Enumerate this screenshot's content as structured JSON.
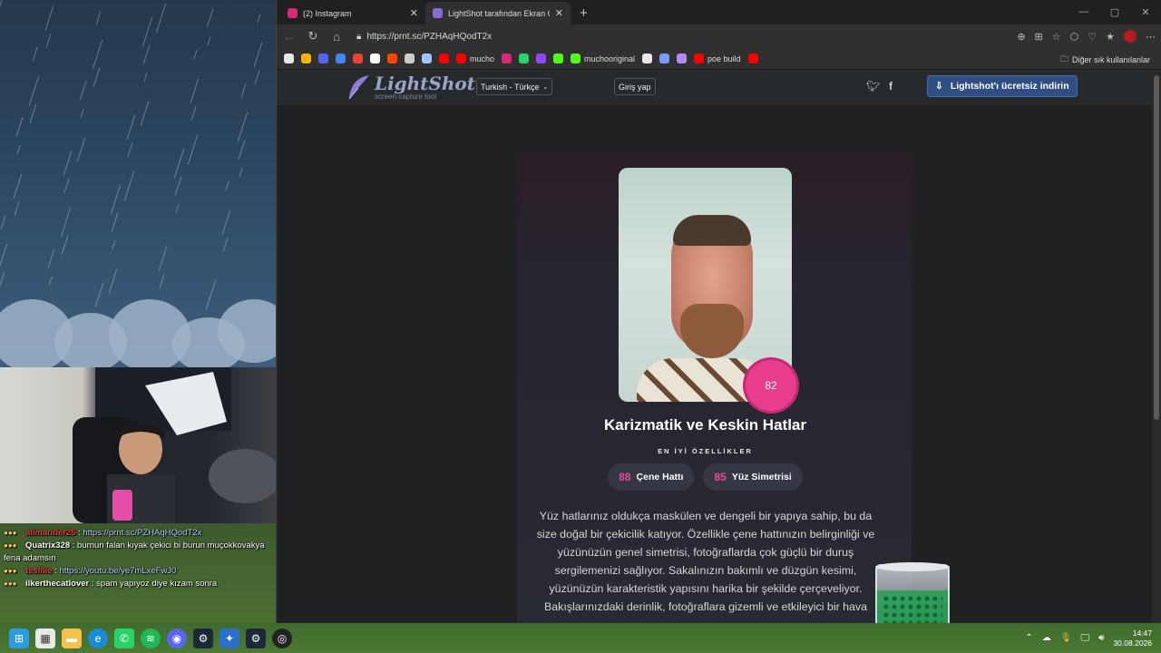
{
  "chat": [
    {
      "user": "alimander25",
      "user_color": "red",
      "sep": " : ",
      "message": "https://prnt.sc/PZHAqHQodT2x",
      "is_link": true
    },
    {
      "user": "Quatrix328",
      "user_color": "white",
      "sep": " : ",
      "message": "burnun falan kıyak çekici bi burun muçokkovakya fena adamsın",
      "is_link": false
    },
    {
      "user": "teslilie",
      "user_color": "red",
      "sep": " : ",
      "message": "https://youtu.be/ye7mLxeFwJ0",
      "is_link": true
    },
    {
      "user": "ilkerthecatlover",
      "user_color": "white",
      "sep": " : ",
      "message": "spam yapıyoz diye kızam sonra",
      "is_link": false
    }
  ],
  "browser": {
    "tabs": [
      {
        "title": "(2) Instagram",
        "icon_color": "#d62976",
        "active": false
      },
      {
        "title": "LightShot tarafından Ekran Görünt",
        "icon_color": "#8a6bd8",
        "active": true
      }
    ],
    "new_tab": "+",
    "url": "https://prnt.sc/PZHAqHQodT2x",
    "bookmarks": [
      {
        "label": "",
        "color": "#e8e8e8"
      },
      {
        "label": "",
        "color": "#f4b400"
      },
      {
        "label": "",
        "color": "#5865f2"
      },
      {
        "label": "",
        "color": "#4285f4"
      },
      {
        "label": "",
        "color": "#ea4335"
      },
      {
        "label": "",
        "color": "#ffffff"
      },
      {
        "label": "",
        "color": "#ff4500"
      },
      {
        "label": "",
        "color": "#cccccc"
      },
      {
        "label": "",
        "color": "#a0c4ff"
      },
      {
        "label": "",
        "color": "#ff0000"
      },
      {
        "label": "mucho",
        "color": "#ff0000"
      },
      {
        "label": "",
        "color": "#d62976"
      },
      {
        "label": "",
        "color": "#25d366"
      },
      {
        "label": "",
        "color": "#9146ff"
      },
      {
        "label": "",
        "color": "#53fc18"
      },
      {
        "label": "muchooriginal",
        "color": "#53fc18"
      },
      {
        "label": "",
        "color": "#e8e8e8"
      },
      {
        "label": "",
        "color": "#7b9cff"
      },
      {
        "label": "",
        "color": "#b388ff"
      },
      {
        "label": "poe build",
        "color": "#ff0000"
      },
      {
        "label": "",
        "color": "#ff0000"
      }
    ],
    "other_bookmarks": "Diğer sık kullanılanlar"
  },
  "lightshot": {
    "logo_name": "LightShot",
    "logo_tag": "screen capture tool",
    "language": "Turkish - Türkçe",
    "login": "Giriş yap",
    "download": "Lightshot'ı ücretsiz indirin"
  },
  "result": {
    "score": "82",
    "title": "Karizmatik ve Keskin Hatlar",
    "best_label": "EN İYİ ÖZELLİKLER",
    "features": [
      {
        "score": "88",
        "label": "Çene Hattı"
      },
      {
        "score": "85",
        "label": "Yüz Simetrisi"
      }
    ],
    "description": "Yüz hatlarınız oldukça maskülen ve dengeli bir yapıya sahip, bu da size doğal bir çekicilik katıyor. Özellikle çene hattınızın belirginliği ve yüzünüzün genel simetrisi, fotoğraflarda çok güçlü bir duruş sergilemenizi sağlıyor. Sakalınızın bakımlı ve düzgün kesimi, yüzünüzün karakteristik yapısını harika bir şekilde çerçeveliyor. Bakışlarınızdaki derinlik, fotoğraflara gizemli ve etkileyici bir hava"
  },
  "taskbar": {
    "time": "14:47",
    "date": "30.08.2026"
  }
}
